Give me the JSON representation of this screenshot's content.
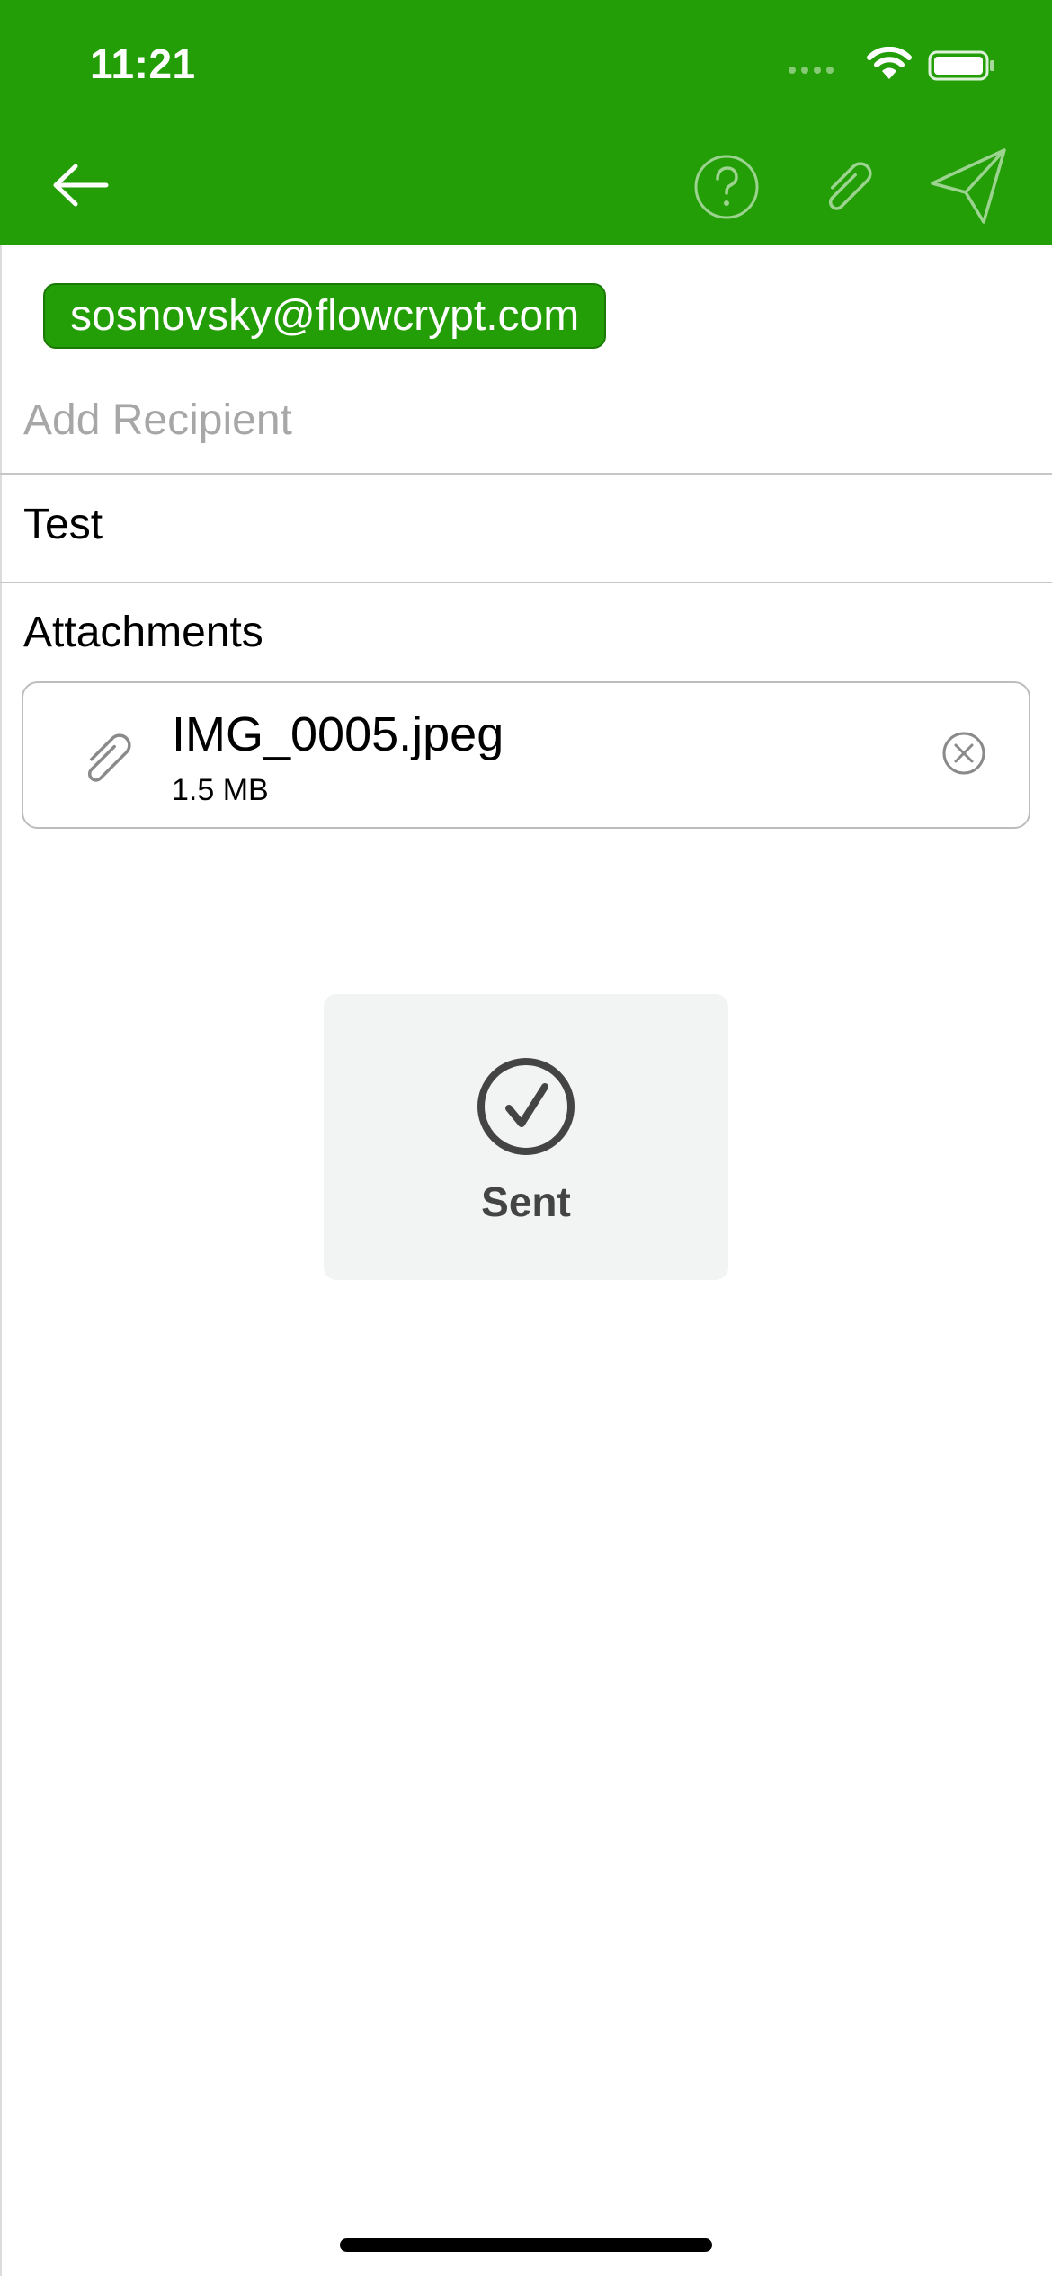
{
  "status_bar": {
    "time": "11:21"
  },
  "toolbar": {
    "back_icon": "arrow-left-icon",
    "help_icon": "question-circle-icon",
    "attach_icon": "paperclip-icon",
    "send_icon": "paper-plane-icon"
  },
  "compose": {
    "recipient_chip": "sosnovsky@flowcrypt.com",
    "add_recipient_placeholder": "Add Recipient",
    "subject": "Test",
    "attachments_label": "Attachments",
    "attachments": [
      {
        "name": "IMG_0005.jpeg",
        "size": "1.5 MB"
      }
    ]
  },
  "hud": {
    "label": "Sent",
    "icon": "checkmark-circle-icon"
  },
  "colors": {
    "brand_green": "#239e07",
    "chip_border": "#1a7a05",
    "hud_background": "#f2f3f3"
  }
}
